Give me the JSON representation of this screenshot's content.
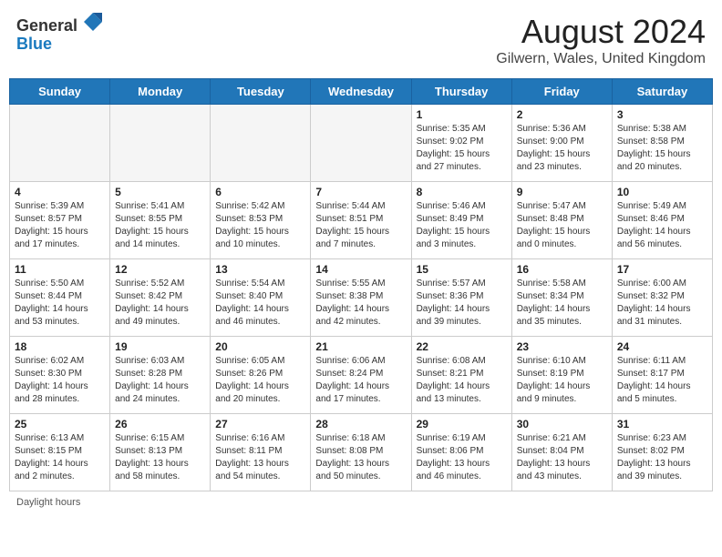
{
  "header": {
    "logo_general": "General",
    "logo_blue": "Blue",
    "month_title": "August 2024",
    "location": "Gilwern, Wales, United Kingdom"
  },
  "days_of_week": [
    "Sunday",
    "Monday",
    "Tuesday",
    "Wednesday",
    "Thursday",
    "Friday",
    "Saturday"
  ],
  "weeks": [
    [
      {
        "day": "",
        "content": ""
      },
      {
        "day": "",
        "content": ""
      },
      {
        "day": "",
        "content": ""
      },
      {
        "day": "",
        "content": ""
      },
      {
        "day": "1",
        "content": "Sunrise: 5:35 AM\nSunset: 9:02 PM\nDaylight: 15 hours and 27 minutes."
      },
      {
        "day": "2",
        "content": "Sunrise: 5:36 AM\nSunset: 9:00 PM\nDaylight: 15 hours and 23 minutes."
      },
      {
        "day": "3",
        "content": "Sunrise: 5:38 AM\nSunset: 8:58 PM\nDaylight: 15 hours and 20 minutes."
      }
    ],
    [
      {
        "day": "4",
        "content": "Sunrise: 5:39 AM\nSunset: 8:57 PM\nDaylight: 15 hours and 17 minutes."
      },
      {
        "day": "5",
        "content": "Sunrise: 5:41 AM\nSunset: 8:55 PM\nDaylight: 15 hours and 14 minutes."
      },
      {
        "day": "6",
        "content": "Sunrise: 5:42 AM\nSunset: 8:53 PM\nDaylight: 15 hours and 10 minutes."
      },
      {
        "day": "7",
        "content": "Sunrise: 5:44 AM\nSunset: 8:51 PM\nDaylight: 15 hours and 7 minutes."
      },
      {
        "day": "8",
        "content": "Sunrise: 5:46 AM\nSunset: 8:49 PM\nDaylight: 15 hours and 3 minutes."
      },
      {
        "day": "9",
        "content": "Sunrise: 5:47 AM\nSunset: 8:48 PM\nDaylight: 15 hours and 0 minutes."
      },
      {
        "day": "10",
        "content": "Sunrise: 5:49 AM\nSunset: 8:46 PM\nDaylight: 14 hours and 56 minutes."
      }
    ],
    [
      {
        "day": "11",
        "content": "Sunrise: 5:50 AM\nSunset: 8:44 PM\nDaylight: 14 hours and 53 minutes."
      },
      {
        "day": "12",
        "content": "Sunrise: 5:52 AM\nSunset: 8:42 PM\nDaylight: 14 hours and 49 minutes."
      },
      {
        "day": "13",
        "content": "Sunrise: 5:54 AM\nSunset: 8:40 PM\nDaylight: 14 hours and 46 minutes."
      },
      {
        "day": "14",
        "content": "Sunrise: 5:55 AM\nSunset: 8:38 PM\nDaylight: 14 hours and 42 minutes."
      },
      {
        "day": "15",
        "content": "Sunrise: 5:57 AM\nSunset: 8:36 PM\nDaylight: 14 hours and 39 minutes."
      },
      {
        "day": "16",
        "content": "Sunrise: 5:58 AM\nSunset: 8:34 PM\nDaylight: 14 hours and 35 minutes."
      },
      {
        "day": "17",
        "content": "Sunrise: 6:00 AM\nSunset: 8:32 PM\nDaylight: 14 hours and 31 minutes."
      }
    ],
    [
      {
        "day": "18",
        "content": "Sunrise: 6:02 AM\nSunset: 8:30 PM\nDaylight: 14 hours and 28 minutes."
      },
      {
        "day": "19",
        "content": "Sunrise: 6:03 AM\nSunset: 8:28 PM\nDaylight: 14 hours and 24 minutes."
      },
      {
        "day": "20",
        "content": "Sunrise: 6:05 AM\nSunset: 8:26 PM\nDaylight: 14 hours and 20 minutes."
      },
      {
        "day": "21",
        "content": "Sunrise: 6:06 AM\nSunset: 8:24 PM\nDaylight: 14 hours and 17 minutes."
      },
      {
        "day": "22",
        "content": "Sunrise: 6:08 AM\nSunset: 8:21 PM\nDaylight: 14 hours and 13 minutes."
      },
      {
        "day": "23",
        "content": "Sunrise: 6:10 AM\nSunset: 8:19 PM\nDaylight: 14 hours and 9 minutes."
      },
      {
        "day": "24",
        "content": "Sunrise: 6:11 AM\nSunset: 8:17 PM\nDaylight: 14 hours and 5 minutes."
      }
    ],
    [
      {
        "day": "25",
        "content": "Sunrise: 6:13 AM\nSunset: 8:15 PM\nDaylight: 14 hours and 2 minutes."
      },
      {
        "day": "26",
        "content": "Sunrise: 6:15 AM\nSunset: 8:13 PM\nDaylight: 13 hours and 58 minutes."
      },
      {
        "day": "27",
        "content": "Sunrise: 6:16 AM\nSunset: 8:11 PM\nDaylight: 13 hours and 54 minutes."
      },
      {
        "day": "28",
        "content": "Sunrise: 6:18 AM\nSunset: 8:08 PM\nDaylight: 13 hours and 50 minutes."
      },
      {
        "day": "29",
        "content": "Sunrise: 6:19 AM\nSunset: 8:06 PM\nDaylight: 13 hours and 46 minutes."
      },
      {
        "day": "30",
        "content": "Sunrise: 6:21 AM\nSunset: 8:04 PM\nDaylight: 13 hours and 43 minutes."
      },
      {
        "day": "31",
        "content": "Sunrise: 6:23 AM\nSunset: 8:02 PM\nDaylight: 13 hours and 39 minutes."
      }
    ]
  ],
  "footer": "Daylight hours"
}
